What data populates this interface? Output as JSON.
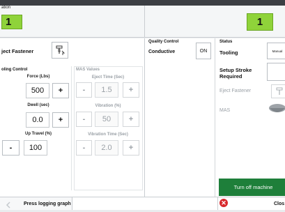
{
  "top_left": {
    "tab_label": "ation",
    "station_number": "1"
  },
  "top_right": {
    "station_number": "1"
  },
  "eject": {
    "label": "ject Fastener"
  },
  "tooling_control": {
    "title": "oling Control",
    "force": {
      "label": "Force (Lbs)",
      "value": "500",
      "plus": "+"
    },
    "dwell": {
      "label": "Dwell (sec)",
      "value": "0.0",
      "plus": "+"
    },
    "up_travel": {
      "label": "Up Travel (%)",
      "value": "100",
      "minus": "-"
    }
  },
  "mas_values": {
    "title": "MAS Values",
    "eject_time": {
      "label": "Eject Time (Sec)",
      "value": "1.5",
      "minus": "-",
      "plus": "+"
    },
    "vibration": {
      "label": "Vibration (%)",
      "value": "50",
      "minus": "-",
      "plus": "+"
    },
    "vibration_time": {
      "label": "Vibration Time (Sec)",
      "value": "2.0",
      "minus": "-",
      "plus": "+"
    }
  },
  "quality_control": {
    "title": "Quality Control",
    "conductive_label": "Conductive",
    "conductive_state": "ON"
  },
  "status": {
    "title": "Status",
    "tooling_label": "Tooling",
    "tooling_value": "Manual",
    "setup_stroke_label_1": "Setup Stroke",
    "setup_stroke_label_2": "Required",
    "eject_fastener_label": "Eject Fastener",
    "mas_label": "MAS"
  },
  "turn_off": {
    "label": "Turn off machine"
  },
  "footer": {
    "press_logging": "Press logging graph",
    "close": "Clos"
  },
  "colors": {
    "accent_green": "#8fd33a",
    "dark_green": "#1e7f3a",
    "close_red": "#d8282c"
  }
}
